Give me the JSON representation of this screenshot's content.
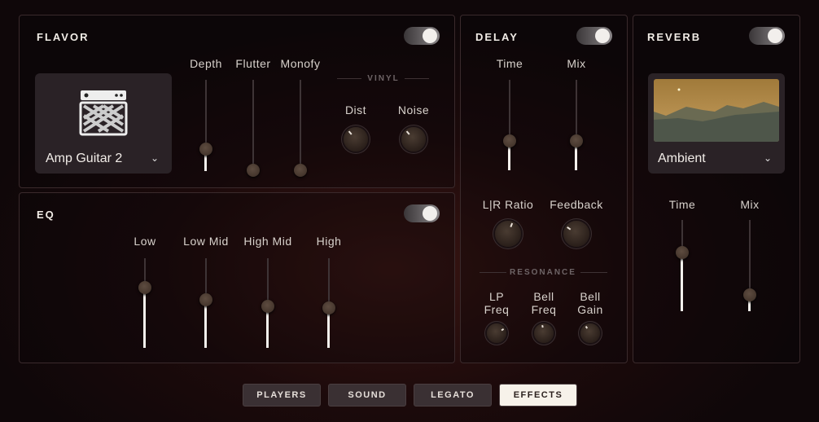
{
  "flavor": {
    "title": "FLAVOR",
    "enabled": true,
    "preset": "Amp Guitar 2",
    "sliders": [
      {
        "label": "Depth",
        "value": 0.2
      },
      {
        "label": "Flutter",
        "value": 0.0
      },
      {
        "label": "Monofy",
        "value": 0.0
      }
    ],
    "vinyl_label": "VINYL",
    "knobs": [
      {
        "label": "Dist",
        "value": 0.35
      },
      {
        "label": "Noise",
        "value": 0.35
      }
    ]
  },
  "eq": {
    "title": "EQ",
    "enabled": true,
    "sliders": [
      {
        "label": "Low",
        "value": 0.7
      },
      {
        "label": "Low Mid",
        "value": 0.54
      },
      {
        "label": "High Mid",
        "value": 0.46
      },
      {
        "label": "High",
        "value": 0.44
      }
    ]
  },
  "delay": {
    "title": "DELAY",
    "enabled": true,
    "sliders": [
      {
        "label": "Time",
        "value": 0.3
      },
      {
        "label": "Mix",
        "value": 0.29
      }
    ],
    "knobs": [
      {
        "label": "L|R Ratio",
        "value": 0.58
      },
      {
        "label": "Feedback",
        "value": 0.3
      }
    ],
    "resonance_label": "RESONANCE",
    "res_knobs": [
      {
        "label": "LP",
        "label2": "Freq",
        "value": 0.72
      },
      {
        "label": "Bell",
        "label2": "Freq",
        "value": 0.46
      },
      {
        "label": "Bell",
        "label2": "Gain",
        "value": 0.38
      }
    ]
  },
  "reverb": {
    "title": "REVERB",
    "enabled": true,
    "preset": "Ambient",
    "sliders": [
      {
        "label": "Time",
        "value": 0.67
      },
      {
        "label": "Mix",
        "value": 0.12
      }
    ]
  },
  "tabs": [
    {
      "label": "PLAYERS",
      "active": false
    },
    {
      "label": "SOUND",
      "active": false
    },
    {
      "label": "LEGATO",
      "active": false
    },
    {
      "label": "EFFECTS",
      "active": true
    }
  ]
}
